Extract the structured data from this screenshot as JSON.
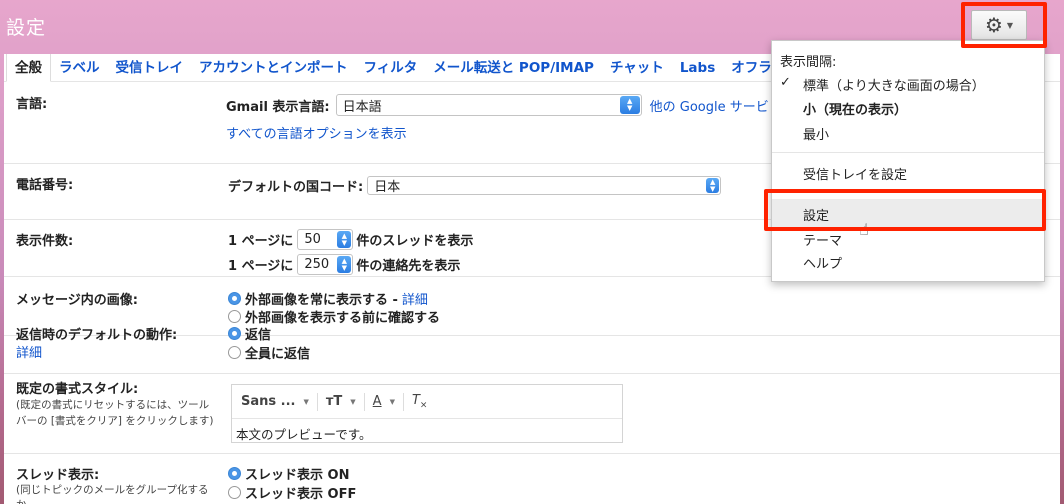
{
  "header": {
    "title": "設定"
  },
  "tabs": [
    "全般",
    "ラベル",
    "受信トレイ",
    "アカウントとインポート",
    "フィルタ",
    "メール転送と POP/IMAP",
    "チャット",
    "Labs",
    "オフラ"
  ],
  "settings": {
    "language": {
      "label": "言語:",
      "display_label": "Gmail 表示言語:",
      "value": "日本語",
      "other_link": "他の Google サービ",
      "all_options_link": "すべての言語オプションを表示"
    },
    "phone": {
      "label": "電話番号:",
      "country_label": "デフォルトの国コード:",
      "value": "日本"
    },
    "page_size": {
      "label": "表示件数:",
      "prefix": "1 ページに",
      "threads_value": "50",
      "threads_suffix": "件のスレッドを表示",
      "contacts_value": "250",
      "contacts_suffix": "件の連絡先を表示"
    },
    "images": {
      "label": "メッセージ内の画像:",
      "option_always": "外部画像を常に表示する -",
      "details_link": "詳細",
      "option_ask": "外部画像を表示する前に確認する"
    },
    "reply": {
      "label": "返信時のデフォルトの動作:",
      "details_link": "詳細",
      "option_reply": "返信",
      "option_reply_all": "全員に返信"
    },
    "format": {
      "label": "既定の書式スタイル:",
      "note_line1": "(既定の書式にリセットするには、ツール",
      "note_line2": "バーの [書式をクリア] をクリックします)",
      "font": "Sans ...",
      "preview": "本文のプレビューです。"
    },
    "threads": {
      "label": "スレッド表示:",
      "note_line1": "(同じトピックのメールをグループ化する",
      "note_line2": "か",
      "option_on": "スレッド表示 ON",
      "option_off": "スレッド表示 OFF"
    }
  },
  "menu": {
    "density_header": "表示間隔:",
    "check_mark": "✓",
    "density_comfortable": "標準（より大きな画面の場合）",
    "density_cozy": "小（現在の表示）",
    "density_compact": "最小",
    "configure_inbox": "受信トレイを設定",
    "settings": "設定",
    "themes": "テーマ",
    "help": "ヘルプ"
  },
  "colors": {
    "accent": "#ff2200",
    "link": "#1155cc",
    "theme_pink": "#dc9ec8"
  }
}
